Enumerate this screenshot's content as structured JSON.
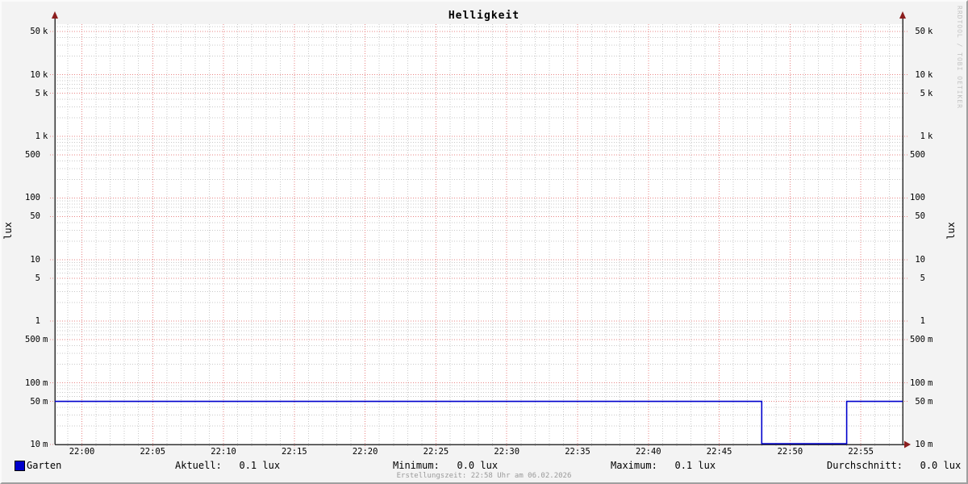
{
  "title": "Helligkeit",
  "watermark": "RRDTOOL / TOBI OETIKER",
  "y_axis_unit_left": "lux",
  "y_axis_unit_right": "lux",
  "footer": "Erstellungszeit: 22:58 Uhr am 06.02.2026",
  "legend": {
    "series_label": "Garten",
    "color": "#0000cc",
    "stats": [
      {
        "name": "aktuell",
        "text": "Aktuell:   0.1 lux"
      },
      {
        "name": "minimum",
        "text": "Minimum:   0.0 lux"
      },
      {
        "name": "maximum",
        "text": "Maximum:   0.1 lux"
      },
      {
        "name": "durchschnitt",
        "text": "Durchschnitt:   0.0 lux"
      }
    ]
  },
  "chart_data": {
    "type": "line",
    "title": "Helligkeit",
    "ylabel": "lux",
    "y_scale": "log",
    "ylim_lux": [
      0.01,
      66000
    ],
    "time_window": [
      "21:58",
      "22:58"
    ],
    "x_minor_step_minutes": 1,
    "x_major_ticks": [
      "22:00",
      "22:05",
      "22:10",
      "22:15",
      "22:20",
      "22:25",
      "22:30",
      "22:35",
      "22:40",
      "22:45",
      "22:50",
      "22:55"
    ],
    "y_major_ticks": [
      {
        "value": 0.01,
        "num": "10",
        "suffix": "m"
      },
      {
        "value": 0.05,
        "num": "50",
        "suffix": "m"
      },
      {
        "value": 0.1,
        "num": "100",
        "suffix": "m"
      },
      {
        "value": 0.5,
        "num": "500",
        "suffix": "m"
      },
      {
        "value": 1,
        "num": "1",
        "suffix": ""
      },
      {
        "value": 5,
        "num": "5",
        "suffix": ""
      },
      {
        "value": 10,
        "num": "10",
        "suffix": ""
      },
      {
        "value": 50,
        "num": "50",
        "suffix": ""
      },
      {
        "value": 100,
        "num": "100",
        "suffix": ""
      },
      {
        "value": 500,
        "num": "500",
        "suffix": ""
      },
      {
        "value": 1000,
        "num": "1",
        "suffix": "k"
      },
      {
        "value": 5000,
        "num": "5",
        "suffix": "k"
      },
      {
        "value": 10000,
        "num": "10",
        "suffix": "k"
      },
      {
        "value": 50000,
        "num": "50",
        "suffix": "k"
      }
    ],
    "grid": {
      "on": true,
      "major_color": "#e88484",
      "minor_color": "#c9c9c9"
    },
    "axis_color": "#333333",
    "arrow_color": "#8b1e1e",
    "series": [
      {
        "name": "Garten",
        "color": "#0000cc",
        "unit": "lux",
        "points": [
          [
            "21:58",
            0.05
          ],
          [
            "22:48",
            0.05
          ],
          [
            "22:48",
            0
          ],
          [
            "22:54",
            0
          ],
          [
            "22:54",
            0.05
          ],
          [
            "22:58",
            0.05
          ]
        ]
      }
    ],
    "summary": {
      "aktuell": "0.1 lux",
      "minimum": "0.0 lux",
      "maximum": "0.1 lux",
      "durchschnitt": "0.0 lux"
    }
  }
}
